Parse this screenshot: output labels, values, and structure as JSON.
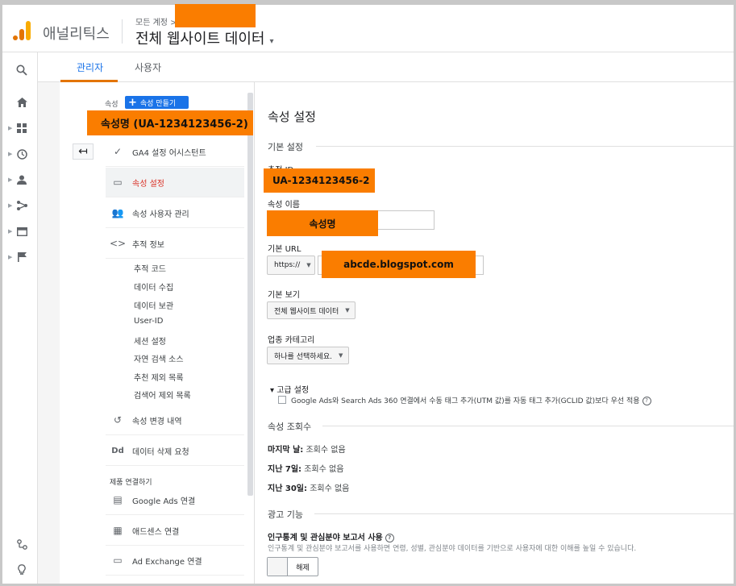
{
  "app": {
    "name": "애널리틱스",
    "breadcrumb": "모든 계정 >",
    "view_title": "전체 웹사이트 데이터",
    "view_caret": "▾"
  },
  "tabs": [
    {
      "label": "관리자",
      "active": true
    },
    {
      "label": "사용자",
      "active": false
    }
  ],
  "left_nav": [
    "search-icon",
    "home-icon",
    "dashboard-icon",
    "clock-icon",
    "person-icon",
    "acquisition-icon",
    "behavior-icon",
    "flag-icon",
    "connect-icon",
    "lightbulb-icon"
  ],
  "property_column": {
    "label": "속성",
    "create_button": "속성 만들기",
    "selected_property": "속성명 (UA-1234123456-2)",
    "back_icon": "↤",
    "items": [
      {
        "label": "GA4 설정 어시스턴트",
        "icon": "✓"
      },
      {
        "label": "속성 설정",
        "icon": "▭"
      },
      {
        "label": "속성 사용자 관리",
        "icon": "👥"
      },
      {
        "label": "추적 정보",
        "icon": "<>"
      }
    ],
    "sub_items": [
      "추적 코드",
      "데이터 수집",
      "데이터 보관",
      "User-ID",
      "세션 설정",
      "자연 검색 소스",
      "추천 제외 목록",
      "검색어 제외 목록"
    ],
    "more_items": [
      {
        "label": "속성 변경 내역",
        "icon": "↺"
      },
      {
        "label": "데이터 삭제 요청",
        "icon": "Dd"
      }
    ],
    "section_head": "제품 연결하기",
    "link_items": [
      {
        "label": "Google Ads 연결",
        "icon": "▤"
      },
      {
        "label": "애드센스 연결",
        "icon": "▦"
      },
      {
        "label": "Ad Exchange 연결",
        "icon": "▭"
      }
    ]
  },
  "settings": {
    "page_title": "속성 설정",
    "basic_head": "기본 설정",
    "tracking_id_label": "추적 ID",
    "tracking_id": "UA-1234123456-2",
    "property_name_label": "속성 이름",
    "property_name": "속성명",
    "default_url_label": "기본 URL",
    "protocol": "https://",
    "default_url": "abcde.blogspot.com",
    "default_view_label": "기본 보기",
    "default_view": "전체 웹사이트 데이터",
    "industry_label": "업종 카테고리",
    "industry_placeholder": "하나를 선택하세요.",
    "advanced_toggle": "고급 설정",
    "advanced_caret": "▾",
    "advanced_option": "Google Ads와 Search Ads 360 연결에서 수동 태그 추가(UTM 값)를 자동 태그 추가(GCLID 값)보다 우선 적용",
    "views_head": "속성 조회수",
    "views": [
      {
        "label": "마지막 날:",
        "value": "조회수 없음"
      },
      {
        "label": "지난 7일:",
        "value": "조회수 없음"
      },
      {
        "label": "지난 30일:",
        "value": "조회수 없음"
      }
    ],
    "ad_head": "광고 기능",
    "demo_title": "인구통계 및 관심분야 보고서 사용",
    "demo_desc": "인구통계 및 관심분야 보고서를 사용하면 연령, 성별, 관심분야 데이터를 기반으로 사용자에 대한 이해를 높일 수 있습니다.",
    "toggle_label": "해제",
    "help_glyph": "?"
  }
}
